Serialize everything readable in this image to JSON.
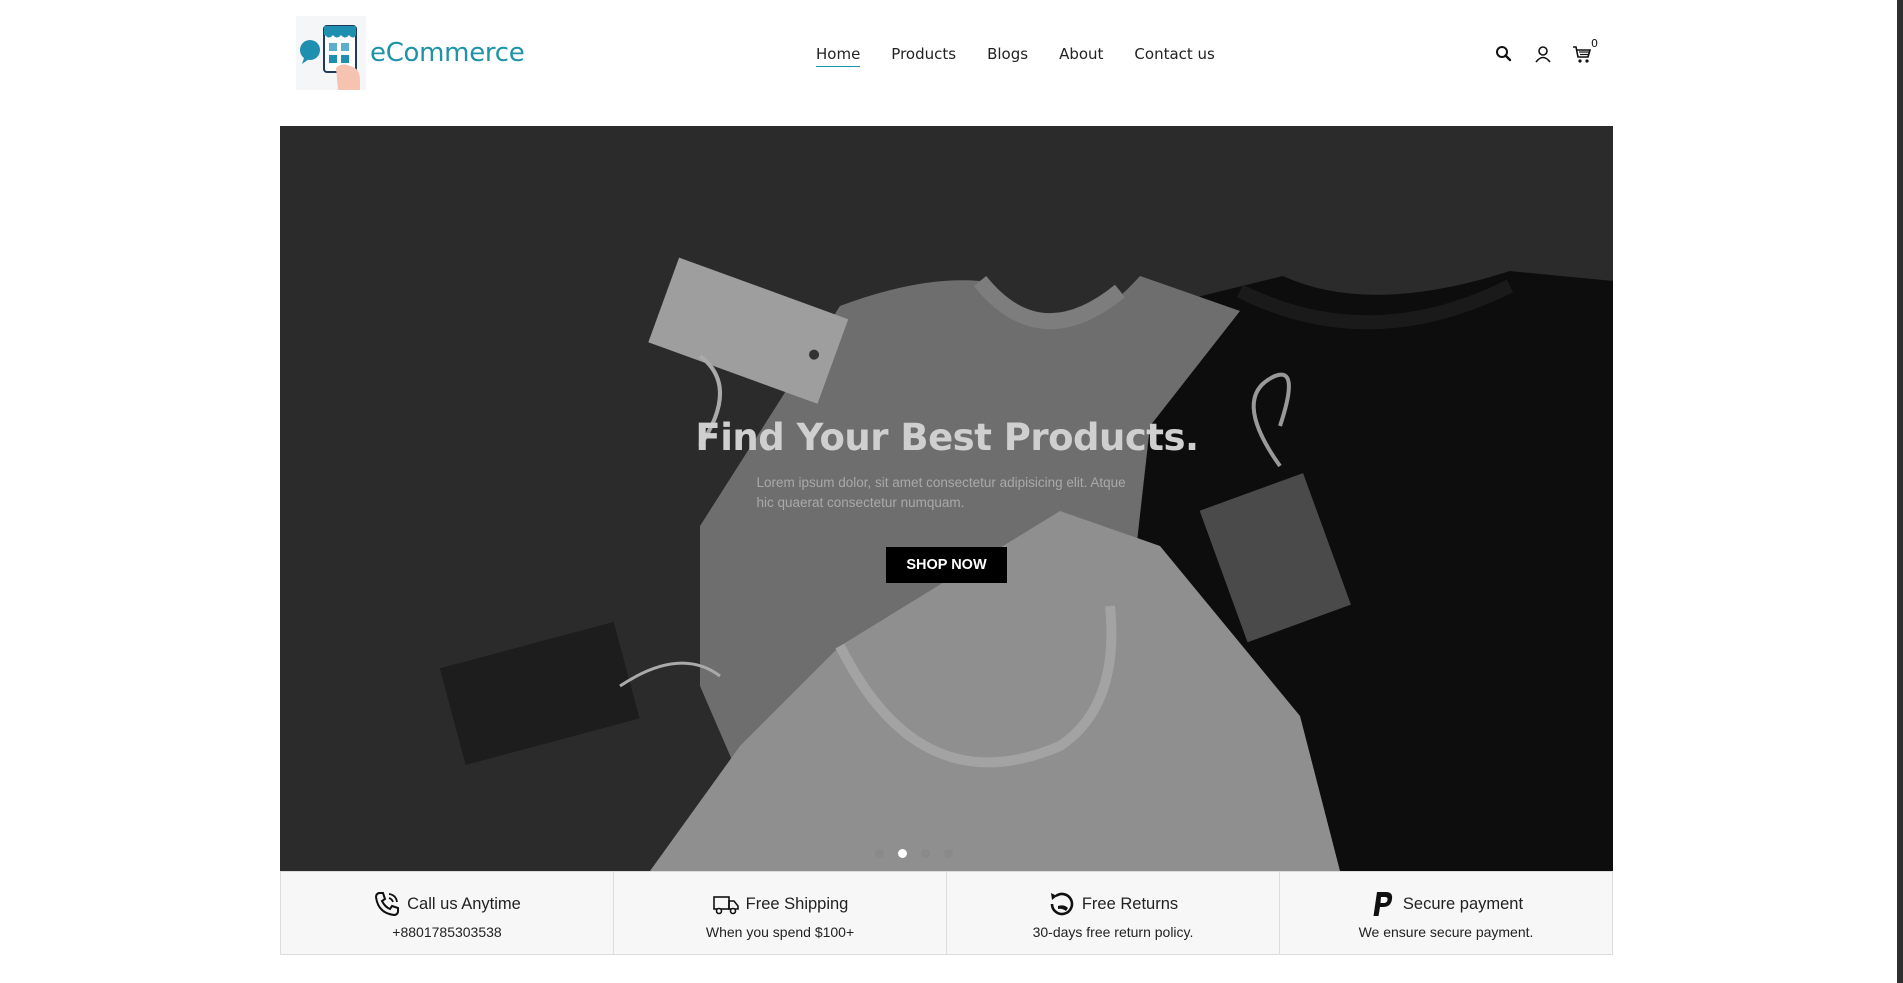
{
  "brand": {
    "name": "eCommerce",
    "color": "#1f93a8"
  },
  "nav": {
    "items": [
      {
        "label": "Home",
        "active": true
      },
      {
        "label": "Products"
      },
      {
        "label": "Blogs"
      },
      {
        "label": "About"
      },
      {
        "label": "Contact us"
      }
    ]
  },
  "header_icons": {
    "search": "search-icon",
    "account": "user-icon",
    "cart": "cart-icon",
    "cart_count": "0"
  },
  "hero": {
    "title": "Find Your Best Products.",
    "subtitle": "Lorem ipsum dolor, sit amet consectetur adipisicing elit. Atque hic quaerat consectetur numquam.",
    "button_label": "SHOP NOW",
    "slides_total": 4,
    "active_slide": 2
  },
  "features": [
    {
      "icon": "phone-icon",
      "title": "Call us Anytime",
      "desc": "+8801785303538"
    },
    {
      "icon": "truck-icon",
      "title": "Free Shipping",
      "desc": "When you spend $100+"
    },
    {
      "icon": "return-icon",
      "title": "Free Returns",
      "desc": "30-days free return policy."
    },
    {
      "icon": "paypal-icon",
      "title": "Secure payment",
      "desc": "We ensure secure payment."
    }
  ]
}
